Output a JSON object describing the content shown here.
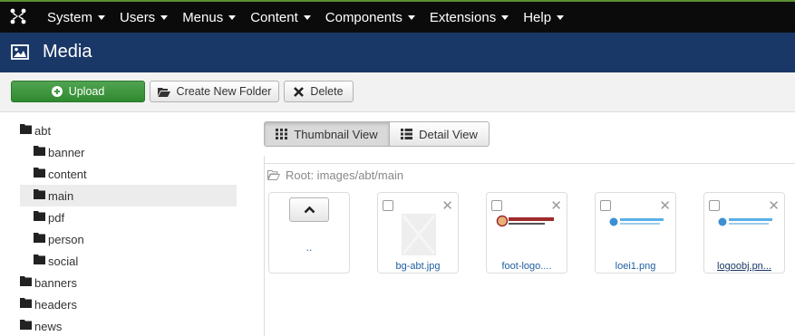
{
  "nav": {
    "items": [
      {
        "label": "System"
      },
      {
        "label": "Users"
      },
      {
        "label": "Menus"
      },
      {
        "label": "Content"
      },
      {
        "label": "Components"
      },
      {
        "label": "Extensions"
      },
      {
        "label": "Help"
      }
    ],
    "logo_icon": "joomla-logo-icon",
    "dropdown_icon": "caret-down-icon"
  },
  "header": {
    "title": "Media",
    "icon": "image-icon"
  },
  "toolbar": {
    "upload_label": "Upload",
    "upload_icon": "plus-circle-icon",
    "new_folder_label": "Create New Folder",
    "new_folder_icon": "folder-open-icon",
    "delete_label": "Delete",
    "delete_icon": "times-icon"
  },
  "tree": {
    "folders": [
      {
        "label": "abt",
        "level": 0
      },
      {
        "label": "banner",
        "level": 1
      },
      {
        "label": "content",
        "level": 1
      },
      {
        "label": "main",
        "level": 1,
        "active": true
      },
      {
        "label": "pdf",
        "level": 1
      },
      {
        "label": "person",
        "level": 1
      },
      {
        "label": "social",
        "level": 1
      },
      {
        "label": "banners",
        "level": 0
      },
      {
        "label": "headers",
        "level": 0
      },
      {
        "label": "news",
        "level": 0
      }
    ]
  },
  "views": {
    "thumbnail_label": "Thumbnail View",
    "thumbnail_icon": "grid-icon",
    "detail_label": "Detail View",
    "detail_icon": "list-icon",
    "active": "thumbnail"
  },
  "breadcrumb": {
    "text": "Root: images/abt/main",
    "icon": "folder-open-icon"
  },
  "thumbnails": {
    "up": {
      "label": ".."
    },
    "items": [
      {
        "name": "bg-abt.jpg",
        "preview": "placeholder-image"
      },
      {
        "name": "foot-logo....",
        "preview": "municipality-logo"
      },
      {
        "name": "loei1.png",
        "preview": "blue-logo"
      },
      {
        "name": "logoobj.pn...",
        "preview": "blue-logo",
        "underline": true
      }
    ]
  },
  "colors": {
    "navbar": "#0b0b0b",
    "titlebar": "#1a3867",
    "upload_green": "#46a046",
    "link": "#1f5ea0"
  }
}
